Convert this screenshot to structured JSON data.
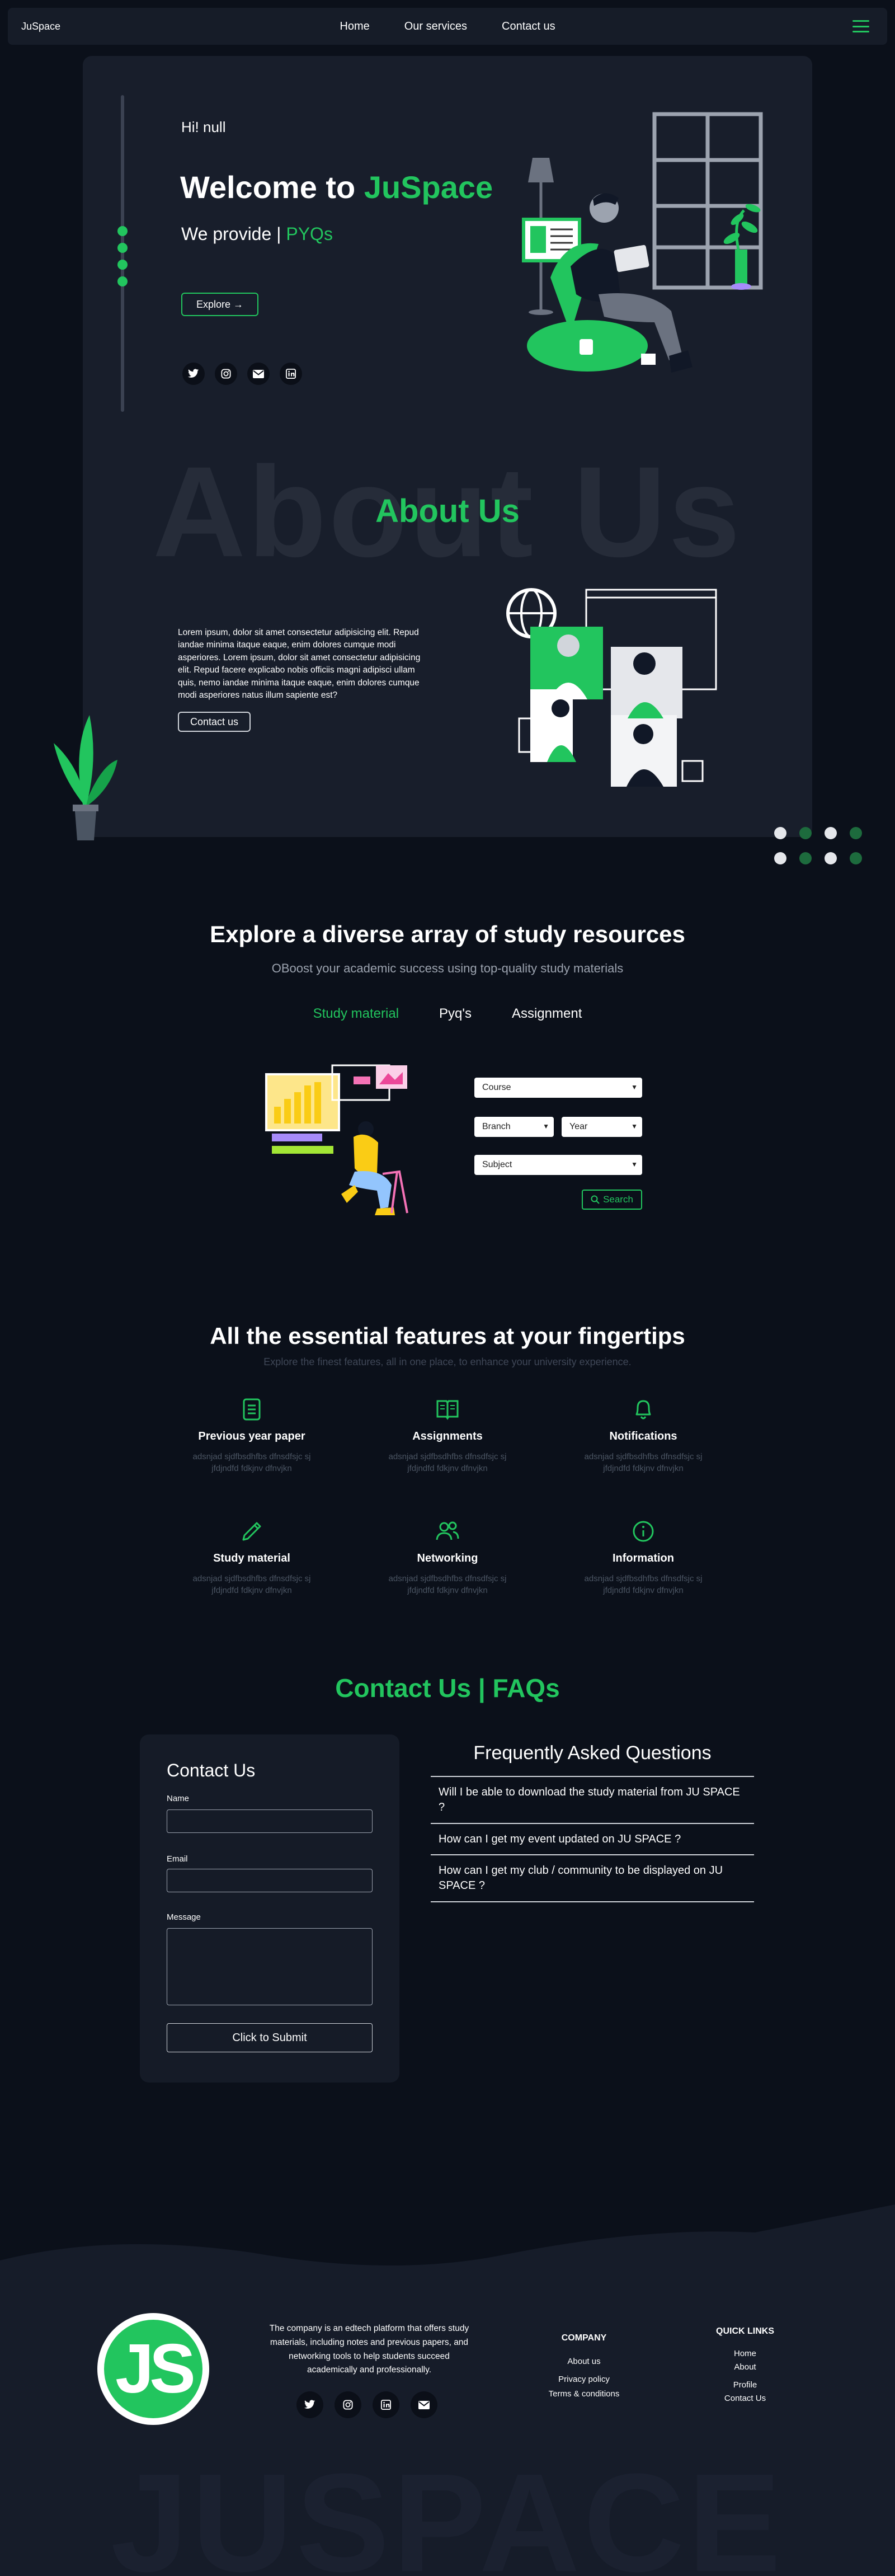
{
  "nav": {
    "brand": "JuSpace",
    "links": [
      "Home",
      "Our services",
      "Contact us"
    ]
  },
  "hero": {
    "greeting": "Hi! null",
    "title_prefix": "Welcome to ",
    "title_accent": "JuSpace",
    "subtitle_prefix": "We provide | ",
    "subtitle_accent": "PYQs",
    "explore_label": "Explore →",
    "socials": [
      "twitter-icon",
      "instagram-icon",
      "mail-icon",
      "linkedin-icon"
    ]
  },
  "about": {
    "background_word": "About Us",
    "title": "About Us",
    "text": "Lorem ipsum, dolor sit amet consectetur adipisicing elit. Repud iandae minima itaque eaque, enim dolores cumque modi asperiores. Lorem ipsum, dolor sit amet consectetur adipisicing elit. Repud facere explicabo nobis officiis magni adipisci ullam quis, nemo iandae minima itaque eaque, enim dolores cumque modi asperiores natus illum sapiente est?",
    "button_label": "Contact us"
  },
  "resources": {
    "title": "Explore a diverse array of study resources",
    "subtitle": "OBoost your academic success using top-quality study materials",
    "tabs": [
      "Study material",
      "Pyq's",
      "Assignment"
    ],
    "active_tab": "Study material",
    "selects": {
      "course": "Course",
      "branch": "Branch",
      "year": "Year",
      "subject": "Subject"
    },
    "search_label": "Search"
  },
  "features": {
    "title": "All the essential features at your fingertips",
    "subtitle": "Explore the finest features, all in one place, to enhance your university experience.",
    "items": [
      {
        "name": "Previous year paper",
        "desc": "adsnjad sjdfbsdhfbs dfnsdfsjc sj jfdjndfd fdkjnv dfnvjkn",
        "icon": "document-icon"
      },
      {
        "name": "Assignments",
        "desc": "adsnjad sjdfbsdhfbs dfnsdfsjc sj jfdjndfd fdkjnv dfnvjkn",
        "icon": "open-book-icon"
      },
      {
        "name": "Notifications",
        "desc": "adsnjad sjdfbsdhfbs dfnsdfsjc sj jfdjndfd fdkjnv dfnvjkn",
        "icon": "bell-icon"
      },
      {
        "name": "Study material",
        "desc": "adsnjad sjdfbsdhfbs dfnsdfsjc sj jfdjndfd fdkjnv dfnvjkn",
        "icon": "pencil-icon"
      },
      {
        "name": "Networking",
        "desc": "adsnjad sjdfbsdhfbs dfnsdfsjc sj jfdjndfd fdkjnv dfnvjkn",
        "icon": "users-icon"
      },
      {
        "name": "Information",
        "desc": "adsnjad sjdfbsdhfbs dfnsdfsjc sj jfdjndfd fdkjnv dfnvjkn",
        "icon": "info-icon"
      }
    ]
  },
  "contact": {
    "heading": "Contact Us | FAQs",
    "form_title": "Contact Us",
    "name_label": "Name",
    "email_label": "Email",
    "message_label": "Message",
    "submit_label": "Click to Submit",
    "faq_title": "Frequently Asked Questions",
    "faqs": [
      "Will I be able to download the study material from JU SPACE ?",
      "How can I get my event updated on JU SPACE ?",
      "How can I get my club / community to be displayed on JU SPACE ?"
    ]
  },
  "footer": {
    "logo_text": "JS",
    "about": "The company is an edtech platform that offers study materials, including notes and previous papers, and networking tools to help students succeed academically and professionally.",
    "company_title": "COMPANY",
    "company_links": [
      "About us",
      "Privacy policy",
      "Terms & conditions"
    ],
    "quick_title": "QUICK LINKS",
    "quick_links": [
      "Home",
      "About",
      "Profile",
      "Contact Us"
    ],
    "socials": [
      "twitter-icon",
      "instagram-icon",
      "linkedin-icon",
      "mail-icon"
    ],
    "background_word": "JUSPACE"
  },
  "colors": {
    "accent": "#22c55e",
    "background": "#0b101a",
    "card": "#181e2b"
  }
}
